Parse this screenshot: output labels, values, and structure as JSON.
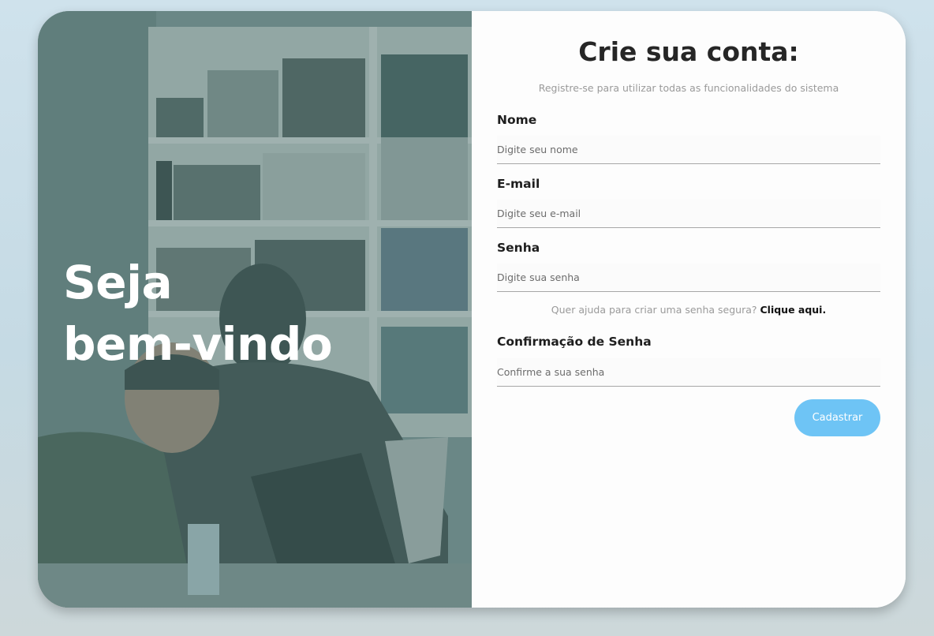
{
  "hero": {
    "line1": "Seja",
    "line2": "bem-vindo"
  },
  "form": {
    "title": "Crie sua conta:",
    "subtitle": "Registre-se para utilizar todas as funcionalidades do sistema",
    "fields": {
      "name": {
        "label": "Nome",
        "placeholder": "Digite seu nome",
        "value": ""
      },
      "email": {
        "label": "E-mail",
        "placeholder": "Digite seu e-mail",
        "value": ""
      },
      "password": {
        "label": "Senha",
        "placeholder": "Digite sua senha",
        "value": ""
      },
      "confirm": {
        "label": "Confirmação de Senha",
        "placeholder": "Confirme a sua senha",
        "value": ""
      }
    },
    "help_text": "Quer ajuda para criar uma senha segura?",
    "help_link": "Clique aqui.",
    "submit_label": "Cadastrar"
  },
  "colors": {
    "accent": "#6ec4f5",
    "background": "#cfe2ec",
    "overlay": "#4d6f6c"
  }
}
